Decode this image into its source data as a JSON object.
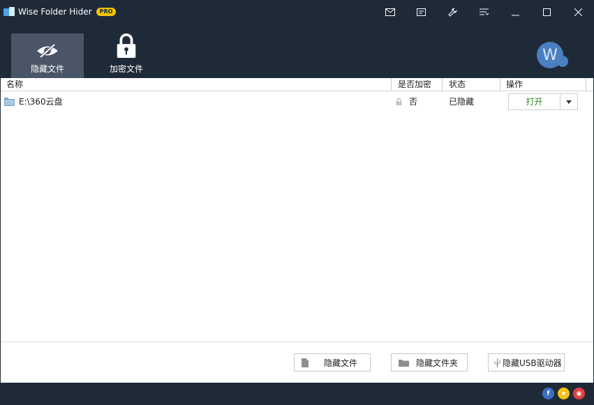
{
  "window": {
    "title": "Wise Folder Hider",
    "badge": "PRO"
  },
  "toolbar": {
    "tabs": [
      {
        "label": "隐藏文件",
        "icon": "hidden-eye-icon",
        "active": true
      },
      {
        "label": "加密文件",
        "icon": "padlock-icon",
        "active": false
      }
    ],
    "avatar_letter": "W"
  },
  "table": {
    "columns": [
      "名称",
      "是否加密",
      "状态",
      "操作"
    ],
    "rows": [
      {
        "name": "E:\\360云盘",
        "encrypted": "否",
        "status": "已隐藏",
        "action": "打开"
      }
    ]
  },
  "bottom": {
    "hide_file": "隐藏文件",
    "hide_folder": "隐藏文件夹",
    "hide_usb": "隐藏USB驱动器"
  },
  "colors": {
    "chrome": "#1f2a38",
    "active_tab": "#4a5567",
    "accent_blue": "#4a7fc1",
    "pro_badge": "#f3c400",
    "open_text": "#2a8a2a"
  }
}
